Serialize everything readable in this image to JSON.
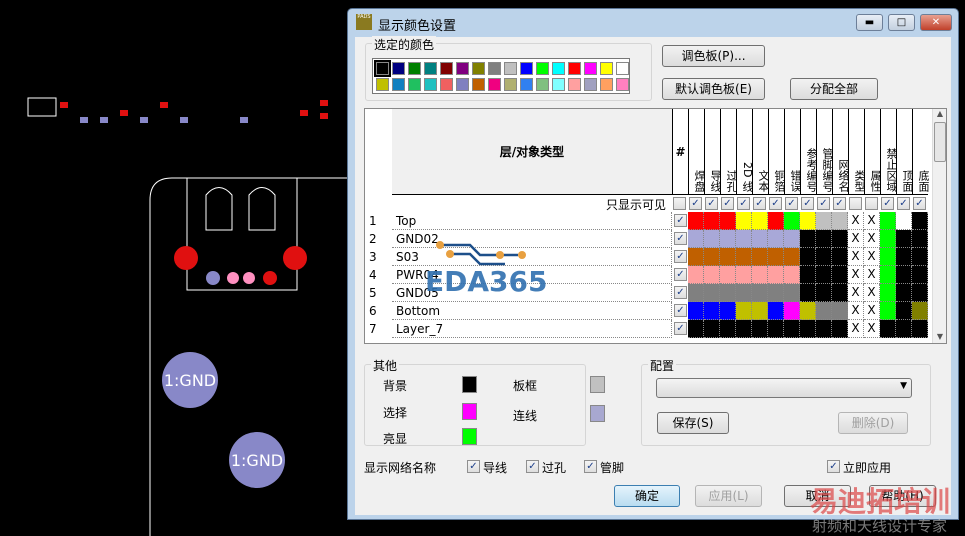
{
  "window": {
    "title": "显示颜色设置",
    "app_icon": "PADS",
    "minimize": "▬",
    "maximize": "□",
    "close": "✕"
  },
  "selected_colors": {
    "label": "选定的颜色",
    "palette": [
      "#000000",
      "#000080",
      "#008000",
      "#008080",
      "#800000",
      "#800080",
      "#808000",
      "#808080",
      "#c0c0c0",
      "#0000ff",
      "#00ff00",
      "#00ffff",
      "#ff0000",
      "#ff00ff",
      "#ffff00",
      "#ffffff",
      "#c0c000",
      "#1080c0",
      "#20c060",
      "#20c0c0",
      "#f06060",
      "#8080c0",
      "#c06000",
      "#f00080",
      "#b0b070",
      "#3080f0",
      "#80c080",
      "#80ffff",
      "#ffa0a0",
      "#a0a0c0",
      "#ffa060",
      "#ff80c0"
    ]
  },
  "buttons": {
    "palette": "调色板(P)...",
    "default_palette": "默认调色板(E)",
    "assign_all": "分配全部",
    "save": "保存(S)",
    "delete": "删除(D)",
    "ok": "确定",
    "apply": "应用(L)",
    "cancel": "取消",
    "help": "帮助(H)"
  },
  "grid": {
    "header": "层/对象类型",
    "hash": "#",
    "visible_only": "只显示可见",
    "columns": [
      "焊盘",
      "导线",
      "过孔",
      "2D 线",
      "文本",
      "铜箔",
      "错误",
      "参考编号",
      "管脚编号",
      "网络名",
      "类型",
      "属性",
      "禁止区域",
      "顶面",
      "底面"
    ],
    "column_checks": [
      false,
      true,
      true,
      true,
      true,
      true,
      true,
      true,
      true,
      true,
      true,
      false,
      false,
      true,
      true,
      true
    ],
    "rows": [
      {
        "num": "1",
        "name": "Top",
        "checked": true,
        "colors": [
          "#ff0000",
          "#ff0000",
          "#ff0000",
          "#ffff00",
          "#ffff00",
          "#ff0000",
          "#00ff00",
          "#ffff00",
          "#c0c0c0",
          "#c0c0c0",
          "X",
          "X",
          "#00ff00",
          "#ffffff",
          "#000000"
        ]
      },
      {
        "num": "2",
        "name": "GND02",
        "checked": true,
        "colors": [
          "#a8a8d8",
          "#a8a8d8",
          "#a8a8d8",
          "#a8a8d8",
          "#a8a8d8",
          "#a8a8d8",
          "#a8a8d8",
          "#000000",
          "#000000",
          "#000000",
          "X",
          "X",
          "#00ff00",
          "#000000",
          "#000000"
        ]
      },
      {
        "num": "3",
        "name": "S03",
        "checked": true,
        "colors": [
          "#c06000",
          "#c06000",
          "#c06000",
          "#c06000",
          "#c06000",
          "#c06000",
          "#c06000",
          "#000000",
          "#000000",
          "#000000",
          "X",
          "X",
          "#00ff00",
          "#000000",
          "#000000"
        ]
      },
      {
        "num": "4",
        "name": "PWR04",
        "checked": true,
        "colors": [
          "#ffa0a0",
          "#ffa0a0",
          "#ffa0a0",
          "#ffa0a0",
          "#ffa0a0",
          "#ffa0a0",
          "#ffa0a0",
          "#000000",
          "#000000",
          "#000000",
          "X",
          "X",
          "#00ff00",
          "#000000",
          "#000000"
        ]
      },
      {
        "num": "5",
        "name": "GND05",
        "checked": true,
        "colors": [
          "#808080",
          "#808080",
          "#808080",
          "#808080",
          "#808080",
          "#808080",
          "#808080",
          "#000000",
          "#000000",
          "#000000",
          "X",
          "X",
          "#00ff00",
          "#000000",
          "#000000"
        ]
      },
      {
        "num": "6",
        "name": "Bottom",
        "checked": true,
        "colors": [
          "#0000ff",
          "#0000ff",
          "#0000ff",
          "#c0c000",
          "#c0c000",
          "#0000ff",
          "#ff00ff",
          "#c0c000",
          "#808080",
          "#808080",
          "X",
          "X",
          "#00ff00",
          "#000000",
          "#808000"
        ]
      },
      {
        "num": "7",
        "name": "Layer_7",
        "checked": true,
        "colors": [
          "#000000",
          "#000000",
          "#000000",
          "#000000",
          "#000000",
          "#000000",
          "#000000",
          "#000000",
          "#000000",
          "#000000",
          "X",
          "X",
          "#000000",
          "#000000",
          "#000000"
        ]
      }
    ]
  },
  "other": {
    "label": "其他",
    "background": {
      "label": "背景",
      "color": "#000000"
    },
    "board_outline": {
      "label": "板框",
      "color": "#c0c0c0"
    },
    "selection": {
      "label": "选择",
      "color": "#ff00ff"
    },
    "connection": {
      "label": "连线",
      "color": "#a8a8d0"
    },
    "highlight": {
      "label": "亮显",
      "color": "#00ff00"
    }
  },
  "config": {
    "label": "配置",
    "value": ""
  },
  "netnames": {
    "label": "显示网络名称",
    "traces": "导线",
    "vias": "过孔",
    "pins": "管脚",
    "apply_now": "立即应用"
  },
  "watermark": {
    "logo": "EDA365",
    "brand": "易迪拓培训",
    "tagline": "射频和天线设计专家"
  }
}
